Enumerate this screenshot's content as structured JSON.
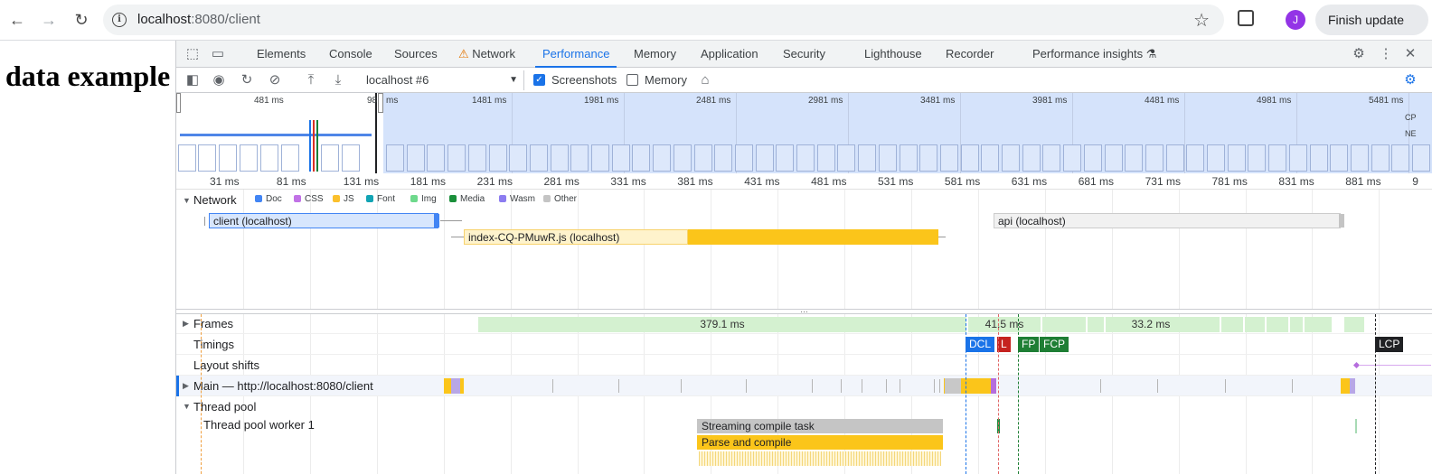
{
  "browser": {
    "url_host": "localhost",
    "url_rest": ":8080/client",
    "avatar_letter": "J",
    "finish_update_label": "Finish update"
  },
  "page": {
    "heading": "data example"
  },
  "devtools": {
    "tabs": [
      "Elements",
      "Console",
      "Sources",
      "Network",
      "Performance",
      "Memory",
      "Application",
      "Security",
      "Lighthouse",
      "Recorder",
      "Performance insights"
    ],
    "active_tab": "Performance",
    "network_tab_warning": true,
    "toolbar": {
      "profile_select": "localhost #6",
      "screenshots_label": "Screenshots",
      "screenshots_checked": true,
      "memory_label": "Memory",
      "memory_checked": false
    },
    "overview": {
      "tick_labels": [
        "481 ms",
        "98",
        "ms",
        "1481 ms",
        "1981 ms",
        "2481 ms",
        "2981 ms",
        "3481 ms",
        "3981 ms",
        "4481 ms",
        "4981 ms",
        "5481 ms"
      ],
      "side_labels": [
        "CP",
        "NE"
      ]
    },
    "ruler_labels": [
      "31 ms",
      "81 ms",
      "131 ms",
      "181 ms",
      "231 ms",
      "281 ms",
      "331 ms",
      "381 ms",
      "431 ms",
      "481 ms",
      "531 ms",
      "581 ms",
      "631 ms",
      "681 ms",
      "731 ms",
      "781 ms",
      "831 ms",
      "881 ms",
      "9"
    ],
    "network": {
      "title": "Network",
      "legend": [
        {
          "label": "Doc",
          "color": "#4285f4"
        },
        {
          "label": "CSS",
          "color": "#c172e6"
        },
        {
          "label": "JS",
          "color": "#fbc02d"
        },
        {
          "label": "Font",
          "color": "#12a4b4"
        },
        {
          "label": "Img",
          "color": "#6ed98c"
        },
        {
          "label": "Media",
          "color": "#1a8f3a"
        },
        {
          "label": "Wasm",
          "color": "#8c7cf0"
        },
        {
          "label": "Other",
          "color": "#c4c4c4"
        }
      ],
      "requests": [
        "client (localhost)",
        "index-CQ-PMuwR.js (localhost)",
        "api (localhost)"
      ]
    },
    "tracks": {
      "frames_label": "Frames",
      "frame_values": [
        "379.1 ms",
        "41.5 ms",
        "33.2 ms"
      ],
      "timings_label": "Timings",
      "timing_markers": [
        "DCL",
        "L",
        "FP",
        "FCP",
        "LCP"
      ],
      "layout_shifts_label": "Layout shifts",
      "main_label": "Main — http://localhost:8080/client",
      "thread_pool_label": "Thread pool",
      "worker_label": "Thread pool worker 1",
      "worker_tasks": [
        "Streaming compile task",
        "Parse and compile"
      ]
    }
  }
}
